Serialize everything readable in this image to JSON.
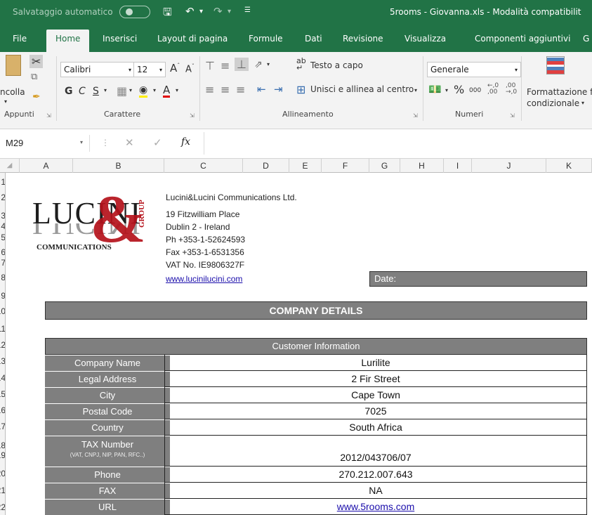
{
  "titlebar": {
    "autosave": "Salvataggio automatico",
    "document": "5rooms - Giovanna.xls  -  Modalità compatibilit"
  },
  "tabs": [
    "File",
    "Home",
    "Inserisci",
    "Layout di pagina",
    "Formule",
    "Dati",
    "Revisione",
    "Visualizza",
    "Componenti aggiuntivi",
    "G"
  ],
  "ribbon": {
    "paste": "ncolla",
    "clipboard_label": "Appunti",
    "font_name": "Calibri",
    "font_size": "12",
    "bold": "G",
    "italic": "C",
    "underline": "S",
    "font_label": "Carattere",
    "wrap_text": "Testo a capo",
    "merge_center": "Unisci e allinea al centro",
    "alignment_label": "Allineamento",
    "number_format": "Generale",
    "percent": "%",
    "thousands": "000",
    "number_label": "Numeri",
    "conditional_1": "Formattazione f",
    "conditional_2": "condizionale"
  },
  "formula_bar": {
    "name_box": "M29",
    "fx": "fx",
    "value": ""
  },
  "columns": [
    "A",
    "B",
    "C",
    "D",
    "E",
    "F",
    "G",
    "H",
    "I",
    "J",
    "K"
  ],
  "rows": [
    "1",
    "2",
    "3",
    "4",
    "5",
    "6",
    "7",
    "8",
    "9",
    "10",
    "11",
    "12",
    "13",
    "14",
    "15",
    "16",
    "17",
    "18",
    "19",
    "20",
    "21",
    "22"
  ],
  "logo": {
    "word": "LUCINI",
    "mirror": "LUCINI",
    "group": "GROUP",
    "communications": "COMMUNICATIONS",
    "ampersand": "&"
  },
  "company": {
    "name": "Lucini&Lucini Communications Ltd.",
    "address_1": "19 Fitzwilliam Place",
    "address_2": "Dublin 2 - Ireland",
    "phone": "Ph +353-1-52624593",
    "fax": "Fax +353-1-6531356",
    "vat": "VAT No. IE9806327F",
    "website": "www.lucinilucini.com",
    "date_label": "Date:"
  },
  "section_title": "COMPANY DETAILS",
  "subsection_title": "Customer Information",
  "fields": [
    {
      "label": "Company Name",
      "value": "Lurilite"
    },
    {
      "label": "Legal Address",
      "value": "2 Fir Street"
    },
    {
      "label": "City",
      "value": "Cape Town"
    },
    {
      "label": "Postal Code",
      "value": "7025"
    },
    {
      "label": "Country",
      "value": "South Africa"
    },
    {
      "label": "TAX Number",
      "note": "(VAT, CNPJ, NIP, PAN, RFC..)",
      "value": "2012/043706/07"
    },
    {
      "label": "Phone",
      "value": "270.212.007.643"
    },
    {
      "label": "FAX",
      "value": "NA"
    },
    {
      "label": "URL",
      "value": "www.5rooms.com"
    }
  ],
  "colors": {
    "excel_green": "#217346",
    "band_gray": "#7f7f7f",
    "logo_red": "#b5121b"
  }
}
